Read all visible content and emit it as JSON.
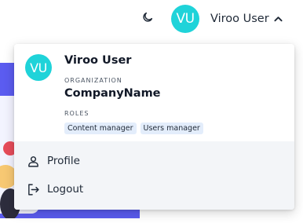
{
  "header": {
    "avatar_initials": "VU",
    "user_name": "Viroo User",
    "theme_icon": "moon-icon",
    "chevron_icon": "chevron-up-icon"
  },
  "menu": {
    "avatar_initials": "VU",
    "user_name": "Viroo User",
    "organization_label": "ORGANIZATION",
    "organization_name": "CompanyName",
    "roles_label": "ROLES",
    "roles": [
      "Content manager",
      "Users manager"
    ],
    "items": [
      {
        "label": "Profile",
        "icon": "user-icon"
      },
      {
        "label": "Logout",
        "icon": "logout-icon"
      }
    ]
  },
  "colors": {
    "avatar": "#1fd3d9",
    "role_badge": "#e3edfb",
    "menu_footer": "#f3f5f8",
    "background_banner": "#5b5cf0"
  }
}
